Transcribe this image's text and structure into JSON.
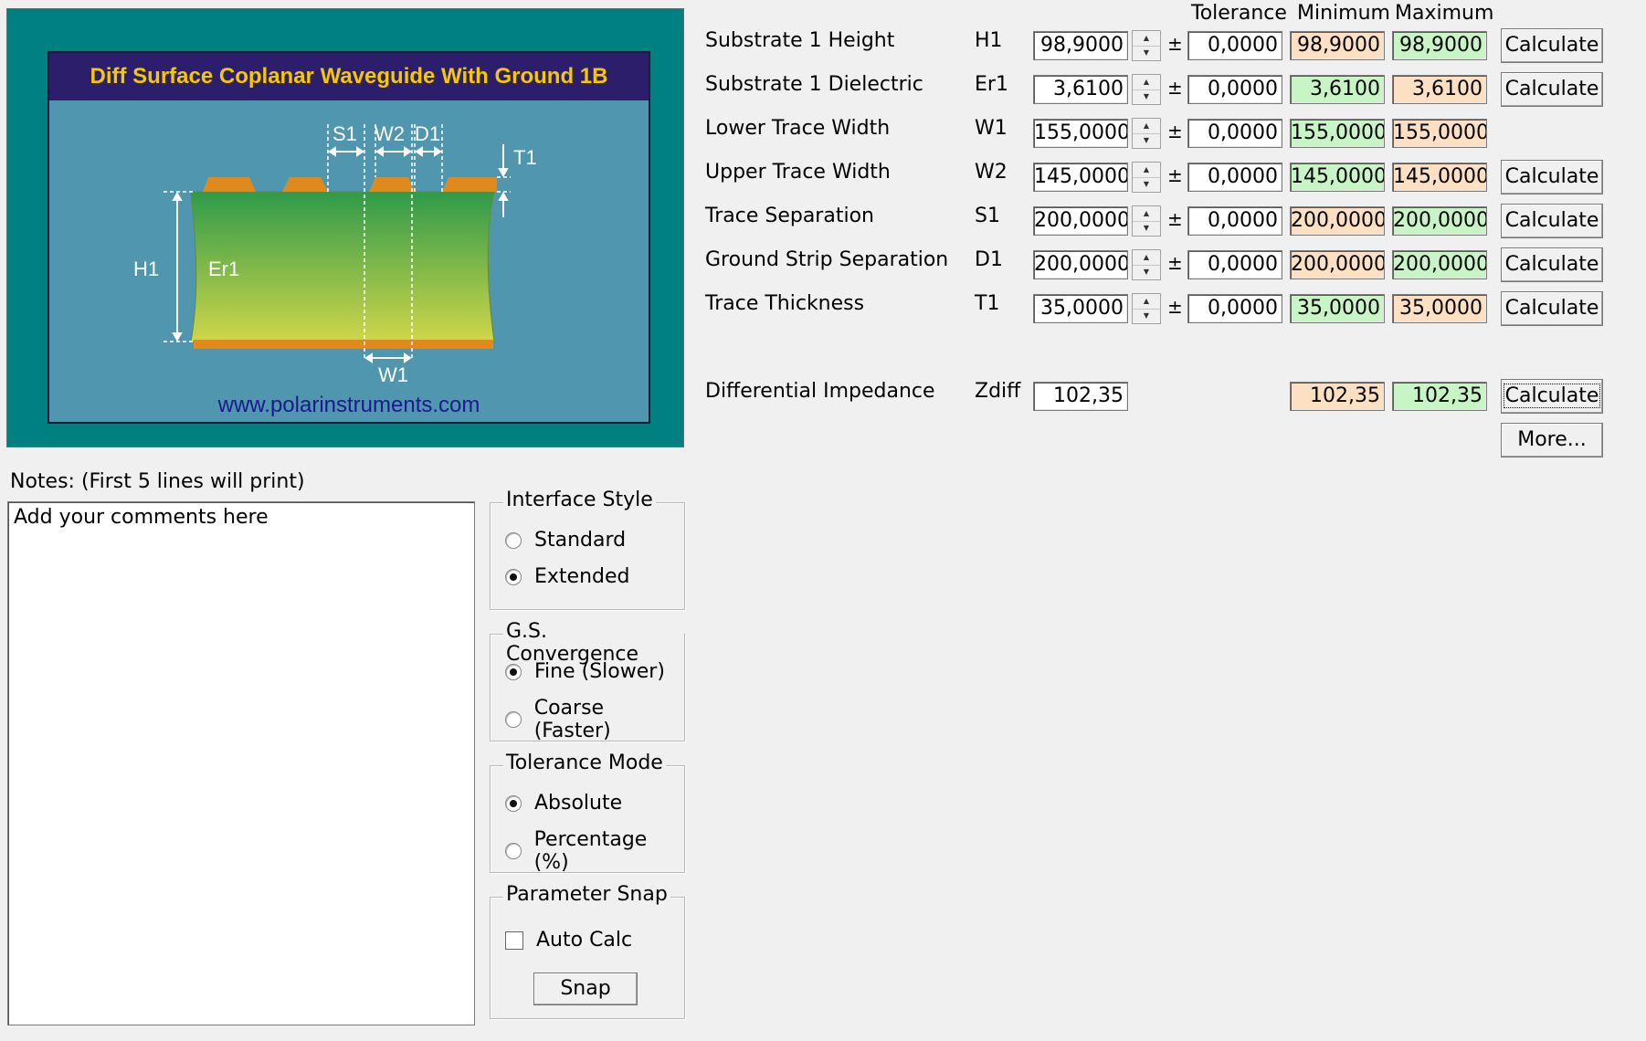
{
  "diagram": {
    "title": "Diff Surface Coplanar Waveguide With Ground 1B",
    "url": "www.polarinstruments.com",
    "labels": {
      "s1": "S1",
      "w2": "W2",
      "d1": "D1",
      "t1": "T1",
      "h1": "H1",
      "er1": "Er1",
      "w1": "W1"
    }
  },
  "columns": {
    "tolerance": "Tolerance",
    "minimum": "Minimum",
    "maximum": "Maximum"
  },
  "plus_minus": "±",
  "rows": [
    {
      "label": "Substrate 1 Height",
      "symbol": "H1",
      "value": "98,9000",
      "tolerance": "0,0000",
      "min": "98,9000",
      "max": "98,9000",
      "min_color": "orange",
      "max_color": "green",
      "button": "Calculate"
    },
    {
      "label": "Substrate 1 Dielectric",
      "symbol": "Er1",
      "value": "3,6100",
      "tolerance": "0,0000",
      "min": "3,6100",
      "max": "3,6100",
      "min_color": "green",
      "max_color": "orange",
      "button": "Calculate"
    },
    {
      "label": "Lower Trace Width",
      "symbol": "W1",
      "value": "155,0000",
      "tolerance": "0,0000",
      "min": "155,0000",
      "max": "155,0000",
      "min_color": "green",
      "max_color": "orange",
      "button": ""
    },
    {
      "label": "Upper Trace Width",
      "symbol": "W2",
      "value": "145,0000",
      "tolerance": "0,0000",
      "min": "145,0000",
      "max": "145,0000",
      "min_color": "green",
      "max_color": "orange",
      "button": "Calculate"
    },
    {
      "label": "Trace Separation",
      "symbol": "S1",
      "value": "200,0000",
      "tolerance": "0,0000",
      "min": "200,0000",
      "max": "200,0000",
      "min_color": "orange",
      "max_color": "green",
      "button": "Calculate"
    },
    {
      "label": "Ground Strip Separation",
      "symbol": "D1",
      "value": "200,0000",
      "tolerance": "0,0000",
      "min": "200,0000",
      "max": "200,0000",
      "min_color": "orange",
      "max_color": "green",
      "button": "Calculate"
    },
    {
      "label": "Trace Thickness",
      "symbol": "T1",
      "value": "35,0000",
      "tolerance": "0,0000",
      "min": "35,0000",
      "max": "35,0000",
      "min_color": "green",
      "max_color": "orange",
      "button": "Calculate"
    }
  ],
  "impedance": {
    "label": "Differential Impedance",
    "symbol": "Zdiff",
    "value": "102,35",
    "min": "102,35",
    "max": "102,35",
    "button": "Calculate",
    "more_button": "More..."
  },
  "notes": {
    "label": "Notes: (First 5 lines will print)",
    "text": "Add your comments here"
  },
  "groups": {
    "interface_style": {
      "title": "Interface Style",
      "options": [
        "Standard",
        "Extended"
      ],
      "selected": 1
    },
    "gs_convergence": {
      "title": "G.S. Convergence",
      "options": [
        "Fine (Slower)",
        "Coarse (Faster)"
      ],
      "selected": 0
    },
    "tolerance_mode": {
      "title": "Tolerance Mode",
      "options": [
        "Absolute",
        "Percentage (%)"
      ],
      "selected": 0
    },
    "parameter_snap": {
      "title": "Parameter Snap",
      "auto_calc_label": "Auto Calc",
      "auto_calc_checked": false,
      "snap_button": "Snap"
    }
  },
  "colors": {
    "teal": "#008080",
    "diagram_bg": "#5096ae",
    "title_bg": "#2c1e6b",
    "title_text": "#f5c800",
    "min_orange": "#fde0c2",
    "max_green": "#c8f5c4"
  }
}
